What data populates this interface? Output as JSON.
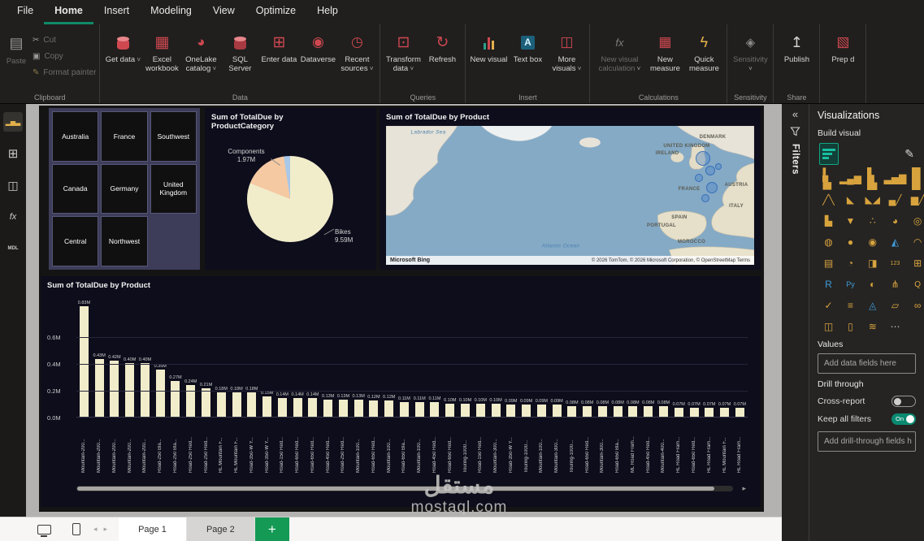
{
  "colors": {
    "accent_teal": "#12a584",
    "accent_green": "#149a55",
    "ribbon_icon_red": "#cf4850",
    "viz_icon_amber": "#d8a33d",
    "bar_fill": "#f1ecca",
    "visual_bg": "#0d0d1c",
    "slicer_bg": "#3d3d5a"
  },
  "menu": {
    "items": [
      "File",
      "Home",
      "Insert",
      "Modeling",
      "View",
      "Optimize",
      "Help"
    ],
    "active_index": 1
  },
  "ribbon": {
    "groups": [
      {
        "label": "Clipboard",
        "layout": "clipboard",
        "buttons": [
          {
            "label": "Paste",
            "icon": "paste-icon",
            "disabled": true
          },
          {
            "label": "Cut",
            "icon": "cut-icon",
            "disabled": true
          },
          {
            "label": "Copy",
            "icon": "copy-icon",
            "disabled": true
          },
          {
            "label": "Format painter",
            "icon": "format-painter-icon",
            "disabled": true
          }
        ]
      },
      {
        "label": "Data",
        "buttons": [
          {
            "label": "Get data",
            "icon": "database-icon",
            "chevron": true
          },
          {
            "label": "Excel workbook",
            "icon": "excel-icon"
          },
          {
            "label": "OneLake catalog",
            "icon": "onelake-icon",
            "chevron": true
          },
          {
            "label": "SQL Server",
            "icon": "sql-server-icon"
          },
          {
            "label": "Enter data",
            "icon": "enter-data-icon"
          },
          {
            "label": "Dataverse",
            "icon": "dataverse-icon"
          },
          {
            "label": "Recent sources",
            "icon": "recent-sources-icon",
            "chevron": true
          }
        ]
      },
      {
        "label": "Queries",
        "buttons": [
          {
            "label": "Transform data",
            "icon": "transform-data-icon",
            "chevron": true
          },
          {
            "label": "Refresh",
            "icon": "refresh-icon"
          }
        ]
      },
      {
        "label": "Insert",
        "buttons": [
          {
            "label": "New visual",
            "icon": "new-visual-icon"
          },
          {
            "label": "Text box",
            "icon": "text-box-icon"
          },
          {
            "label": "More visuals",
            "icon": "more-visuals-icon",
            "chevron": true
          }
        ]
      },
      {
        "label": "Calculations",
        "buttons": [
          {
            "label": "New visual calculation",
            "icon": "visual-calculation-icon",
            "chevron": true,
            "disabled": true
          },
          {
            "label": "New measure",
            "icon": "new-measure-icon"
          },
          {
            "label": "Quick measure",
            "icon": "quick-measure-icon"
          }
        ]
      },
      {
        "label": "Sensitivity",
        "buttons": [
          {
            "label": "Sensitivity",
            "icon": "sensitivity-icon",
            "chevron": true,
            "disabled": true
          }
        ]
      },
      {
        "label": "Share",
        "buttons": [
          {
            "label": "Publish",
            "icon": "publish-icon"
          }
        ]
      },
      {
        "label": "",
        "buttons": [
          {
            "label": "Prep d",
            "icon": "prep-data-icon"
          }
        ]
      }
    ]
  },
  "left_rail": {
    "items": [
      {
        "name": "report-view-icon",
        "active": true
      },
      {
        "name": "table-view-icon"
      },
      {
        "name": "model-view-icon"
      },
      {
        "name": "dax-query-view-icon"
      },
      {
        "name": "tmdl-view-icon"
      }
    ]
  },
  "visuals": {
    "slicer": {
      "tiles": [
        "Australia",
        "France",
        "Southwest",
        "Canada",
        "Germany",
        "United Kingdom",
        "Central",
        "Northwest"
      ]
    }
  },
  "chart_data": [
    {
      "type": "pie",
      "title": "Sum of TotalDue by ProductCategory",
      "slices": [
        {
          "label": "Bikes",
          "value": 9.59,
          "value_label": "9.59M",
          "color": "#f1ecca"
        },
        {
          "label": "Components",
          "value": 1.97,
          "value_label": "1.97M",
          "color": "#f5c9a2"
        },
        {
          "label": "",
          "value": 0.28,
          "value_label": "",
          "color": "#a9c7e8"
        }
      ]
    },
    {
      "type": "map",
      "title": "Sum of TotalDue by Product",
      "sea_labels": [
        {
          "text": "Labrador Sea",
          "x": 52,
          "y": 8
        },
        {
          "text": "Atlantic Ocean",
          "x": 215,
          "y": 148
        }
      ],
      "place_labels": [
        {
          "text": "DENMARK",
          "x": 402,
          "y": 14
        },
        {
          "text": "UNITED KINGDOM",
          "x": 370,
          "y": 25
        },
        {
          "text": "IRELAND",
          "x": 346,
          "y": 34
        },
        {
          "text": "AUSTRIA",
          "x": 431,
          "y": 73
        },
        {
          "text": "FRANCE",
          "x": 373,
          "y": 78
        },
        {
          "text": "ITALY",
          "x": 431,
          "y": 99
        },
        {
          "text": "SPAIN",
          "x": 361,
          "y": 113
        },
        {
          "text": "PORTUGAL",
          "x": 339,
          "y": 123
        },
        {
          "text": "MOROCCO",
          "x": 376,
          "y": 143
        }
      ],
      "bubbles": [
        {
          "x": 390,
          "y": 40,
          "r": 9
        },
        {
          "x": 399,
          "y": 55,
          "r": 6
        },
        {
          "x": 385,
          "y": 64,
          "r": 5
        },
        {
          "x": 401,
          "y": 76,
          "r": 7
        },
        {
          "x": 393,
          "y": 89,
          "r": 5
        },
        {
          "x": 409,
          "y": 50,
          "r": 4
        }
      ],
      "bing_label": "Microsoft Bing",
      "attribution": "© 2026 TomTom, © 2026 Microsoft Corporation, © OpenStreetMap  Terms"
    },
    {
      "type": "bar",
      "title": "Sum of TotalDue by Product",
      "categories": [
        "Mountain-200...",
        "Mountain-200...",
        "Mountain-200...",
        "Mountain-200...",
        "Mountain-200...",
        "Road-250 Bla...",
        "Road-250 Bla...",
        "Road-250 Red...",
        "Road-250 Red...",
        "HL Mountain F...",
        "HL Mountain F...",
        "Road-350-W Y...",
        "Road-350-W Y...",
        "Road-150 Red...",
        "Road-650 Red...",
        "Road-650 Red...",
        "Road-450 Red...",
        "Road-250 Red...",
        "Mountain-100...",
        "Road-650 Red...",
        "Mountain-100...",
        "Road-650 Bla...",
        "Mountain-100...",
        "Road-450 Red...",
        "Road-650 Red...",
        "Touring-1000...",
        "Road-150 Red...",
        "Mountain-300...",
        "Road-350-W Y...",
        "Touring-1000...",
        "Mountain-100...",
        "Mountain-300...",
        "Touring-1000...",
        "Road-650 Red...",
        "Mountain-300...",
        "Road-650 Bla...",
        "ML Road Fram...",
        "Road-450 Red...",
        "Mountain-400...",
        "HL Road Fram...",
        "Road-650 Red...",
        "HL Road Fram...",
        "HL Mountain F...",
        "HL Road Fram..."
      ],
      "values": [
        0.83,
        0.43,
        0.42,
        0.4,
        0.4,
        0.35,
        0.27,
        0.24,
        0.21,
        0.18,
        0.18,
        0.18,
        0.15,
        0.14,
        0.14,
        0.14,
        0.13,
        0.13,
        0.13,
        0.12,
        0.12,
        0.11,
        0.11,
        0.11,
        0.1,
        0.1,
        0.1,
        0.1,
        0.09,
        0.09,
        0.09,
        0.09,
        0.08,
        0.08,
        0.08,
        0.08,
        0.08,
        0.08,
        0.08,
        0.07,
        0.07,
        0.07,
        0.07,
        0.07
      ],
      "y_ticks": [
        "0.0M",
        "0.2M",
        "0.4M",
        "0.6M"
      ],
      "ylim": [
        0,
        0.9
      ],
      "bar_color": "#f1ecca",
      "grid": true,
      "legend": "none"
    }
  ],
  "filters_pane": {
    "title": "Filters"
  },
  "viz_pane": {
    "title": "Visualizations",
    "build_visual_label": "Build visual",
    "visual_icons": [
      "stacked-bar-chart",
      "stacked-column-chart",
      "clustered-bar-chart",
      "clustered-column-chart",
      "100-stacked-bar-chart",
      "100-stacked-column-chart",
      "line-chart",
      "area-chart",
      "stacked-area-chart",
      "line-and-stacked-column-chart",
      "line-and-clustered-column-chart",
      "ribbon-chart",
      "waterfall-chart",
      "funnel-chart",
      "scatter-chart",
      "pie-chart",
      "donut-chart",
      "treemap",
      "map",
      "filled-map",
      "shape-map",
      "azure-map",
      "gauge",
      "card",
      "multi-row-card",
      "kpi",
      "slicer",
      "numeric-card",
      "table",
      "matrix",
      "r-script-visual",
      "python-visual",
      "key-influencers",
      "decomposition-tree",
      "qa-visual",
      "smart-narrative",
      "metrics",
      "paginated-report",
      "arcgis-map",
      "power-apps",
      "power-automate",
      "text-slicer",
      "button-slicer",
      "new-card",
      "accordion",
      "more-options"
    ],
    "values_label": "Values",
    "values_placeholder": "Add data fields here",
    "drill_through_label": "Drill through",
    "cross_report_label": "Cross-report",
    "keep_all_filters_label": "Keep all filters",
    "keep_all_filters_state": "On",
    "drill_field_placeholder": "Add drill-through fields h"
  },
  "page_bar": {
    "pages": [
      "Page 1",
      "Page 2"
    ],
    "active": "Page 2"
  },
  "watermark": {
    "line1": "مستقل",
    "line2": "mostaql.com"
  }
}
